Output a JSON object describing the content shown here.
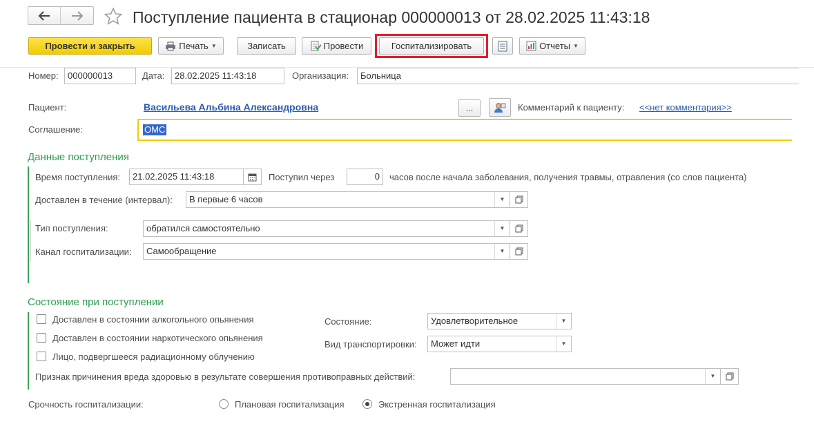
{
  "window": {
    "title": "Поступление пациента в стационар 000000013 от 28.02.2025 11:43:18"
  },
  "toolbar": {
    "post_close": "Провести и закрыть",
    "print": "Печать",
    "save": "Записать",
    "post": "Провести",
    "hospitalize": "Госпитализировать",
    "reports": "Отчеты"
  },
  "header": {
    "number_label": "Номер:",
    "number_value": "000000013",
    "date_label": "Дата:",
    "date_value": "28.02.2025 11:43:18",
    "org_label": "Организация:",
    "org_value": "Больница"
  },
  "patient": {
    "label": "Пациент:",
    "name": "Васильева Альбина Александровна",
    "dots": "...",
    "comment_label": "Комментарий к пациенту:",
    "comment_link": "<<нет комментария>>"
  },
  "agreement": {
    "label": "Соглашение:",
    "value": "ОМС"
  },
  "admission": {
    "section_title": "Данные поступления",
    "time_label": "Время поступления:",
    "time_value": "21.02.2025 11:43:18",
    "arrived_label": "Поступил через",
    "arrived_value": "0",
    "arrived_suffix": "часов после начала заболевания, получения травмы, отравления (со слов пациента)",
    "interval_label": "Доставлен в течение (интервал):",
    "interval_value": "В первые 6 часов",
    "type_label": "Тип поступления:",
    "type_value": "обратился самостоятельно",
    "channel_label": "Канал госпитализации:",
    "channel_value": "Самообращение"
  },
  "condition": {
    "section_title": "Состояние при поступлении",
    "checks": [
      {
        "label": "Доставлен в состоянии алкогольного опьянения",
        "checked": false
      },
      {
        "label": "Доставлен в состоянии наркотического опьянения",
        "checked": false
      },
      {
        "label": "Лицо, подвергшееся радиационному облучению",
        "checked": false
      }
    ],
    "state_label": "Состояние:",
    "state_value": "Удовлетворительное",
    "transport_label": "Вид транспортировки:",
    "transport_value": "Может идти",
    "harm_label": "Признак причинения вреда здоровью в результате совершения противоправных действий:",
    "harm_value": ""
  },
  "urgency": {
    "label": "Срочность госпитализации:",
    "options": [
      {
        "label": "Плановая госпитализация",
        "selected": false
      },
      {
        "label": "Экстренная госпитализация",
        "selected": true
      }
    ]
  },
  "colors": {
    "accent_yellow": "#f5d400",
    "highlight_red": "#e0202a",
    "section_green": "#2e9d4f",
    "link_blue": "#2a5db0"
  }
}
